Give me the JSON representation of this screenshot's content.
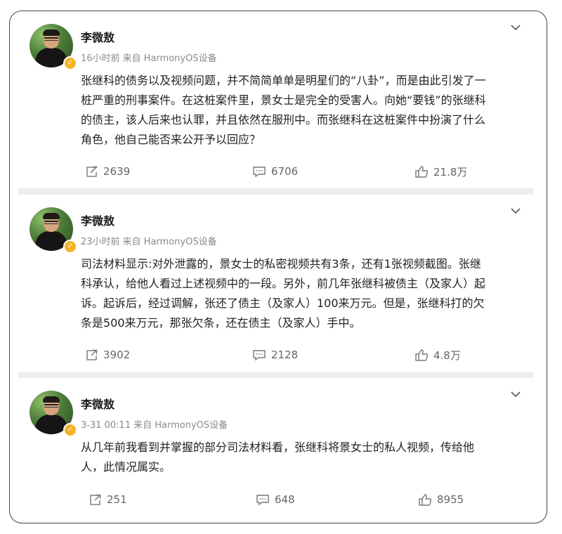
{
  "posts": [
    {
      "author": "李微敖",
      "time": "16小时前",
      "source": "来自 HarmonyOS设备",
      "lines": [
        "张继科的债务以及视频问题，并不简简单单是明星们的“八卦”，而是由此引发了一",
        "桩严重的刑事案件。在这桩案件里，景女士是完全的受害人。向她“要钱”的张继科",
        "的债主，该人后来也认罪，并且依然在服刑中。而张继科在这桩案件中扮演了什么",
        "角色，他自己能否来公开予以回应？"
      ],
      "reposts": "2639",
      "comments": "6706",
      "likes": "21.8万"
    },
    {
      "author": "李微敖",
      "time": "23小时前",
      "source": "来自 HarmonyOS设备",
      "lines": [
        "司法材料显示:对外泄露的，景女士的私密视频共有3条，还有1张视频截图。张继",
        "科承认，给他人看过上述视频中的一段。另外，前几年张继科被债主（及家人）起",
        "诉。起诉后，经过调解，张还了债主（及家人）100来万元。但是，张继科打的欠",
        "条是500来万元，那张欠条，还在债主（及家人）手中。"
      ],
      "reposts": "3902",
      "comments": "2128",
      "likes": "4.8万"
    },
    {
      "author": "李微敖",
      "time": "3-31 00:11",
      "source": "来自 HarmonyOS设备",
      "lines": [
        "从几年前我看到并掌握的部分司法材料看，张继科将景女士的私人视频，传给他",
        "人，此情况属实。"
      ],
      "reposts": "251",
      "comments": "648",
      "likes": "8955"
    }
  ],
  "icons": {
    "repost": "repost-icon",
    "comment": "comment-icon",
    "like": "thumbs-up-icon",
    "more": "chevron-down-icon",
    "verified": "verified-badge-icon"
  },
  "colors": {
    "text": "#222222",
    "meta": "#8a8a8a",
    "action": "#666666",
    "divider": "#eeeeee",
    "badge": "#f4b324"
  }
}
